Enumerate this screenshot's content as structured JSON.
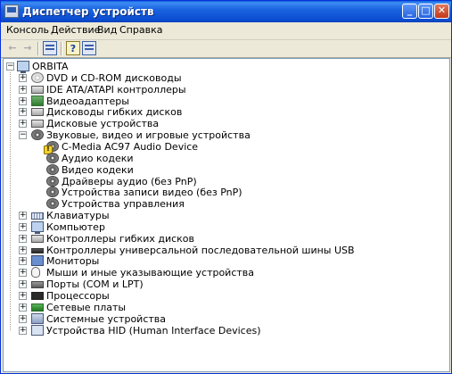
{
  "window": {
    "title": "Диспетчер устройств",
    "controls": {
      "minimize": "_",
      "maximize": "□",
      "close": "✕"
    }
  },
  "menu": [
    "Консоль",
    "Действие",
    "Вид",
    "Справка"
  ],
  "toolbar": {
    "back": "←",
    "forward": "→",
    "items": [
      "properties-icon",
      "help-icon",
      "update-icon",
      "view-icon"
    ]
  },
  "tree": {
    "root": {
      "label": "ORBITA",
      "icon": "computer-icon",
      "expander": "−"
    },
    "nodes": [
      {
        "label": "DVD и CD-ROM дисководы",
        "icon": "cdrom-icon",
        "expander": "+"
      },
      {
        "label": "IDE ATA/ATAPI контроллеры",
        "icon": "ide-controller-icon",
        "expander": "+"
      },
      {
        "label": "Видеоадаптеры",
        "icon": "display-adapter-icon",
        "expander": "+"
      },
      {
        "label": "Дисководы гибких дисков",
        "icon": "floppy-drive-icon",
        "expander": "+"
      },
      {
        "label": "Дисковые устройства",
        "icon": "disk-drive-icon",
        "expander": "+"
      },
      {
        "label": "Звуковые, видео и игровые устройства",
        "icon": "sound-device-icon",
        "expander": "−",
        "children": [
          {
            "label": "C-Media AC97 Audio Device",
            "icon": "warning-sound-icon"
          },
          {
            "label": "Аудио кодеки",
            "icon": "sound-device-icon"
          },
          {
            "label": "Видео кодеки",
            "icon": "sound-device-icon"
          },
          {
            "label": "Драйверы аудио (без PnP)",
            "icon": "sound-device-icon"
          },
          {
            "label": "Устройства записи видео (без PnP)",
            "icon": "sound-device-icon"
          },
          {
            "label": "Устройства управления",
            "icon": "sound-device-icon"
          }
        ]
      },
      {
        "label": "Клавиатуры",
        "icon": "keyboard-icon",
        "expander": "+"
      },
      {
        "label": "Компьютер",
        "icon": "computer-icon",
        "expander": "+"
      },
      {
        "label": "Контроллеры гибких дисков",
        "icon": "floppy-controller-icon",
        "expander": "+"
      },
      {
        "label": "Контроллеры универсальной последовательной шины USB",
        "icon": "usb-icon",
        "expander": "+"
      },
      {
        "label": "Мониторы",
        "icon": "monitor-icon",
        "expander": "+"
      },
      {
        "label": "Мыши и иные указывающие устройства",
        "icon": "mouse-icon",
        "expander": "+"
      },
      {
        "label": "Порты (COM и LPT)",
        "icon": "port-icon",
        "expander": "+"
      },
      {
        "label": "Процессоры",
        "icon": "processor-icon",
        "expander": "+"
      },
      {
        "label": "Сетевые платы",
        "icon": "network-adapter-icon",
        "expander": "+"
      },
      {
        "label": "Системные устройства",
        "icon": "system-device-icon",
        "expander": "+"
      },
      {
        "label": "Устройства HID (Human Interface Devices)",
        "icon": "hid-icon",
        "expander": "+"
      }
    ]
  }
}
